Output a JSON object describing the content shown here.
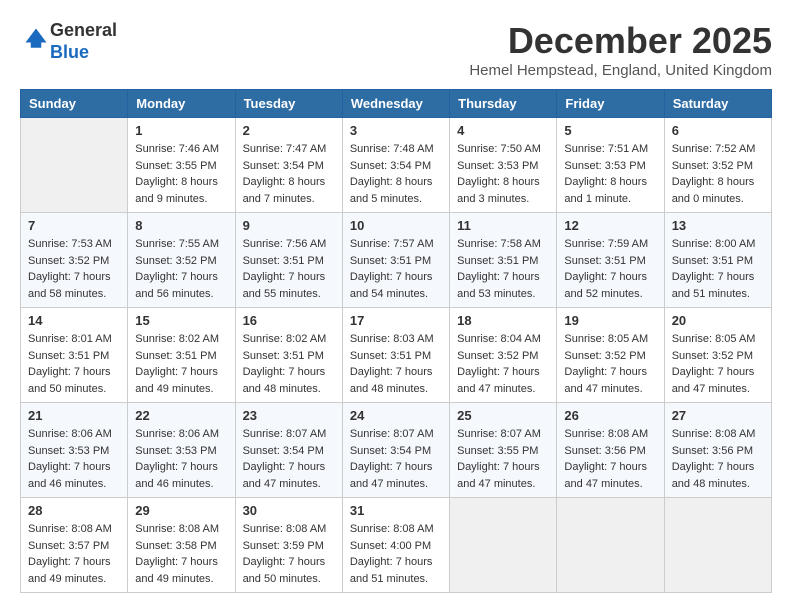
{
  "header": {
    "logo_line1": "General",
    "logo_line2": "Blue",
    "month_title": "December 2025",
    "location": "Hemel Hempstead, England, United Kingdom"
  },
  "weekdays": [
    "Sunday",
    "Monday",
    "Tuesday",
    "Wednesday",
    "Thursday",
    "Friday",
    "Saturday"
  ],
  "weeks": [
    [
      {
        "day": "",
        "sunrise": "",
        "sunset": "",
        "daylight": ""
      },
      {
        "day": "1",
        "sunrise": "Sunrise: 7:46 AM",
        "sunset": "Sunset: 3:55 PM",
        "daylight": "Daylight: 8 hours and 9 minutes."
      },
      {
        "day": "2",
        "sunrise": "Sunrise: 7:47 AM",
        "sunset": "Sunset: 3:54 PM",
        "daylight": "Daylight: 8 hours and 7 minutes."
      },
      {
        "day": "3",
        "sunrise": "Sunrise: 7:48 AM",
        "sunset": "Sunset: 3:54 PM",
        "daylight": "Daylight: 8 hours and 5 minutes."
      },
      {
        "day": "4",
        "sunrise": "Sunrise: 7:50 AM",
        "sunset": "Sunset: 3:53 PM",
        "daylight": "Daylight: 8 hours and 3 minutes."
      },
      {
        "day": "5",
        "sunrise": "Sunrise: 7:51 AM",
        "sunset": "Sunset: 3:53 PM",
        "daylight": "Daylight: 8 hours and 1 minute."
      },
      {
        "day": "6",
        "sunrise": "Sunrise: 7:52 AM",
        "sunset": "Sunset: 3:52 PM",
        "daylight": "Daylight: 8 hours and 0 minutes."
      }
    ],
    [
      {
        "day": "7",
        "sunrise": "Sunrise: 7:53 AM",
        "sunset": "Sunset: 3:52 PM",
        "daylight": "Daylight: 7 hours and 58 minutes."
      },
      {
        "day": "8",
        "sunrise": "Sunrise: 7:55 AM",
        "sunset": "Sunset: 3:52 PM",
        "daylight": "Daylight: 7 hours and 56 minutes."
      },
      {
        "day": "9",
        "sunrise": "Sunrise: 7:56 AM",
        "sunset": "Sunset: 3:51 PM",
        "daylight": "Daylight: 7 hours and 55 minutes."
      },
      {
        "day": "10",
        "sunrise": "Sunrise: 7:57 AM",
        "sunset": "Sunset: 3:51 PM",
        "daylight": "Daylight: 7 hours and 54 minutes."
      },
      {
        "day": "11",
        "sunrise": "Sunrise: 7:58 AM",
        "sunset": "Sunset: 3:51 PM",
        "daylight": "Daylight: 7 hours and 53 minutes."
      },
      {
        "day": "12",
        "sunrise": "Sunrise: 7:59 AM",
        "sunset": "Sunset: 3:51 PM",
        "daylight": "Daylight: 7 hours and 52 minutes."
      },
      {
        "day": "13",
        "sunrise": "Sunrise: 8:00 AM",
        "sunset": "Sunset: 3:51 PM",
        "daylight": "Daylight: 7 hours and 51 minutes."
      }
    ],
    [
      {
        "day": "14",
        "sunrise": "Sunrise: 8:01 AM",
        "sunset": "Sunset: 3:51 PM",
        "daylight": "Daylight: 7 hours and 50 minutes."
      },
      {
        "day": "15",
        "sunrise": "Sunrise: 8:02 AM",
        "sunset": "Sunset: 3:51 PM",
        "daylight": "Daylight: 7 hours and 49 minutes."
      },
      {
        "day": "16",
        "sunrise": "Sunrise: 8:02 AM",
        "sunset": "Sunset: 3:51 PM",
        "daylight": "Daylight: 7 hours and 48 minutes."
      },
      {
        "day": "17",
        "sunrise": "Sunrise: 8:03 AM",
        "sunset": "Sunset: 3:51 PM",
        "daylight": "Daylight: 7 hours and 48 minutes."
      },
      {
        "day": "18",
        "sunrise": "Sunrise: 8:04 AM",
        "sunset": "Sunset: 3:52 PM",
        "daylight": "Daylight: 7 hours and 47 minutes."
      },
      {
        "day": "19",
        "sunrise": "Sunrise: 8:05 AM",
        "sunset": "Sunset: 3:52 PM",
        "daylight": "Daylight: 7 hours and 47 minutes."
      },
      {
        "day": "20",
        "sunrise": "Sunrise: 8:05 AM",
        "sunset": "Sunset: 3:52 PM",
        "daylight": "Daylight: 7 hours and 47 minutes."
      }
    ],
    [
      {
        "day": "21",
        "sunrise": "Sunrise: 8:06 AM",
        "sunset": "Sunset: 3:53 PM",
        "daylight": "Daylight: 7 hours and 46 minutes."
      },
      {
        "day": "22",
        "sunrise": "Sunrise: 8:06 AM",
        "sunset": "Sunset: 3:53 PM",
        "daylight": "Daylight: 7 hours and 46 minutes."
      },
      {
        "day": "23",
        "sunrise": "Sunrise: 8:07 AM",
        "sunset": "Sunset: 3:54 PM",
        "daylight": "Daylight: 7 hours and 47 minutes."
      },
      {
        "day": "24",
        "sunrise": "Sunrise: 8:07 AM",
        "sunset": "Sunset: 3:54 PM",
        "daylight": "Daylight: 7 hours and 47 minutes."
      },
      {
        "day": "25",
        "sunrise": "Sunrise: 8:07 AM",
        "sunset": "Sunset: 3:55 PM",
        "daylight": "Daylight: 7 hours and 47 minutes."
      },
      {
        "day": "26",
        "sunrise": "Sunrise: 8:08 AM",
        "sunset": "Sunset: 3:56 PM",
        "daylight": "Daylight: 7 hours and 47 minutes."
      },
      {
        "day": "27",
        "sunrise": "Sunrise: 8:08 AM",
        "sunset": "Sunset: 3:56 PM",
        "daylight": "Daylight: 7 hours and 48 minutes."
      }
    ],
    [
      {
        "day": "28",
        "sunrise": "Sunrise: 8:08 AM",
        "sunset": "Sunset: 3:57 PM",
        "daylight": "Daylight: 7 hours and 49 minutes."
      },
      {
        "day": "29",
        "sunrise": "Sunrise: 8:08 AM",
        "sunset": "Sunset: 3:58 PM",
        "daylight": "Daylight: 7 hours and 49 minutes."
      },
      {
        "day": "30",
        "sunrise": "Sunrise: 8:08 AM",
        "sunset": "Sunset: 3:59 PM",
        "daylight": "Daylight: 7 hours and 50 minutes."
      },
      {
        "day": "31",
        "sunrise": "Sunrise: 8:08 AM",
        "sunset": "Sunset: 4:00 PM",
        "daylight": "Daylight: 7 hours and 51 minutes."
      },
      {
        "day": "",
        "sunrise": "",
        "sunset": "",
        "daylight": ""
      },
      {
        "day": "",
        "sunrise": "",
        "sunset": "",
        "daylight": ""
      },
      {
        "day": "",
        "sunrise": "",
        "sunset": "",
        "daylight": ""
      }
    ]
  ]
}
